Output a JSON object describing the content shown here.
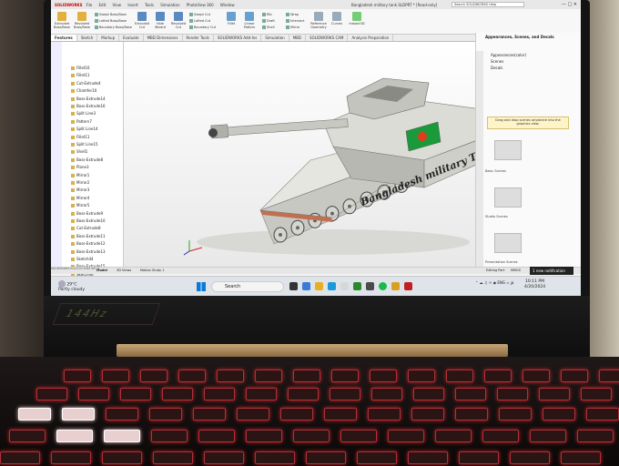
{
  "window": {
    "app_name": "SOLIDWORKS",
    "menus": [
      "File",
      "Edit",
      "View",
      "Insert",
      "Tools",
      "Simulation",
      "PhotoView 360",
      "Window"
    ],
    "doc_title": "Bangladesh military tank.SLDPRT * [Read-only]",
    "search_placeholder": "Search SOLIDWORKS Help"
  },
  "ribbon": {
    "large_commands": [
      "Extruded Boss/Base",
      "Revolved Boss/Base",
      "Extruded Cut",
      "Hole Wizard",
      "Revolved Cut",
      "Fillet",
      "Linear Pattern",
      "Reference Geometry",
      "Curves",
      "Instant3D"
    ],
    "small_commands": [
      "Swept Boss/Base",
      "Lofted Boss/Base",
      "Boundary Boss/Base",
      "Swept Cut",
      "Lofted Cut",
      "Boundary Cut",
      "Rib",
      "Draft",
      "Shell",
      "Wrap",
      "Intersect",
      "Mirror"
    ]
  },
  "tabs": [
    "Features",
    "Sketch",
    "Markup",
    "Evaluate",
    "MBD Dimensions",
    "Render Tools",
    "SOLIDWORKS Add-Ins",
    "Simulation",
    "MBD",
    "SOLIDWORKS CAM",
    "Analysis Preparation"
  ],
  "feature_tree": [
    "Fillet10",
    "Fillet11",
    "Cut-Extrude4",
    "Chamfer10",
    "Boss-Extrude14",
    "Boss-Extrude16",
    "Split Line3",
    "Pattern7",
    "Split Line14",
    "Fillet11",
    "Split Line15",
    "Shell1",
    "Boss-Extrude8",
    "Plane3",
    "Mirror1",
    "Mirror2",
    "Mirror3",
    "Mirror4",
    "Mirror5",
    "Boss-Extrude9",
    "Boss-Extrude10",
    "Cut-Extrude8",
    "Boss-Extrude11",
    "Boss-Extrude12",
    "Boss-Extrude13",
    "Sketch44",
    "Boss-Extrude15",
    "Sketch46"
  ],
  "viewport": {
    "tank_text": "Bangladesh military Tank"
  },
  "taskpane": {
    "title": "Appearances, Scenes, and Decals",
    "tree": [
      "Appearances(color)",
      "Scenes",
      "Decals"
    ],
    "hint": "Drag and drop scenes anywhere into the graphics view.",
    "scenes": [
      "Basic Scenes",
      "Studio Scenes",
      "Presentation Scenes"
    ]
  },
  "status": {
    "model_tabs": [
      "Model",
      "3D Views",
      "Motion Study 1"
    ],
    "version": "SOLIDWORKS Premium 2022 SP1.0",
    "editing": "Editing Part",
    "units": "MMGS"
  },
  "notification": "1 new notification",
  "taskbar": {
    "temperature": "29°C",
    "weather": "Partly cloudy",
    "search": "Search",
    "time": "10:11 PM",
    "date": "4/20/2024",
    "lang": "ENG"
  },
  "laptop": {
    "badge": "144Hz"
  },
  "colors": {
    "flag_green": "#1a9a3a",
    "flag_red": "#e83a1a",
    "tank_body": "#e6e6e0",
    "tank_shadow": "#9a9a94",
    "rust": "#c07050",
    "keyboard_glow": "#c22222"
  }
}
